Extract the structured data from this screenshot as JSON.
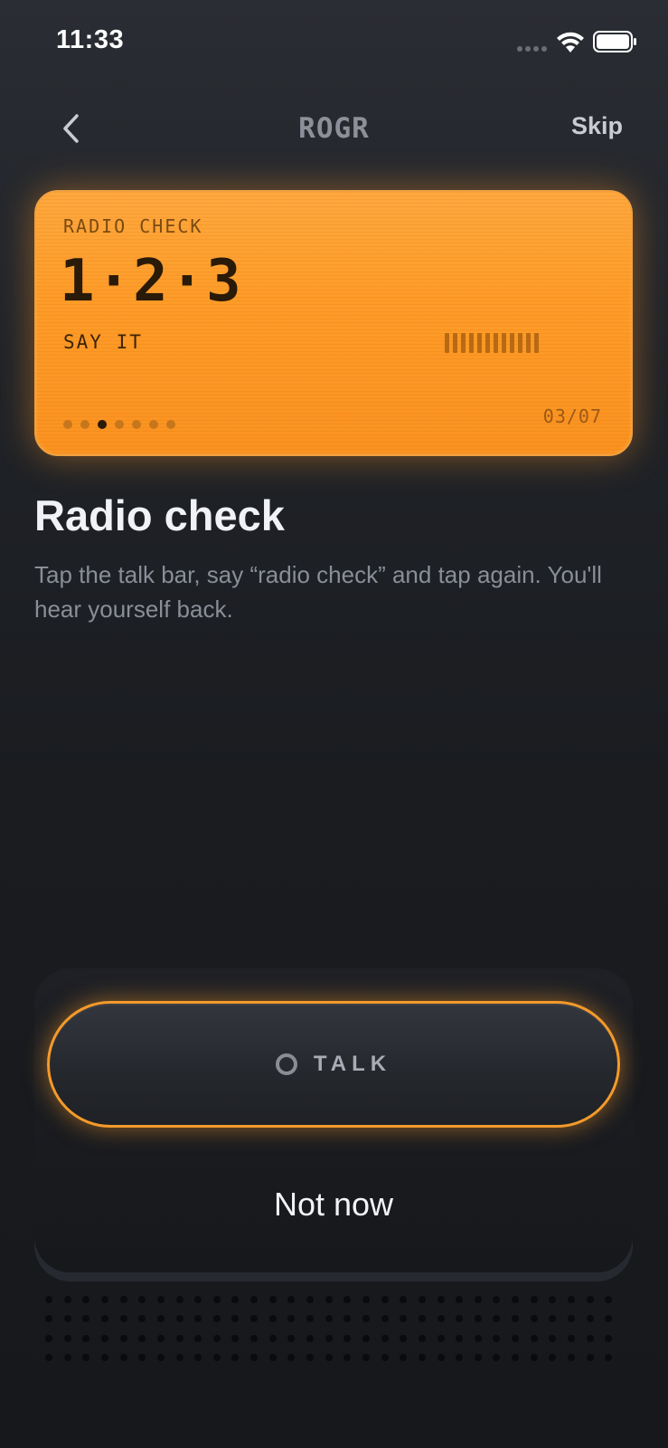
{
  "status_bar": {
    "time": "11:33"
  },
  "nav": {
    "title": "ROGR",
    "skip_label": "Skip"
  },
  "lcd": {
    "label": "RADIO CHECK",
    "digits": "1·2·3",
    "subtitle": "SAY IT",
    "level_bars": 12,
    "step_current": 3,
    "step_total": 7,
    "counter": "03/07",
    "color": "#ff9c28"
  },
  "content": {
    "title": "Radio check",
    "body": "Tap the talk bar, say “radio check” and tap again. You'll hear yourself back."
  },
  "talk": {
    "label": "TALK",
    "accent": "#f49a2a",
    "not_now_label": "Not now"
  },
  "icons": {
    "back": "chevron-left-icon",
    "signal": "signal-icon",
    "wifi": "wifi-icon",
    "battery": "battery-icon",
    "record": "record-ring-icon"
  }
}
